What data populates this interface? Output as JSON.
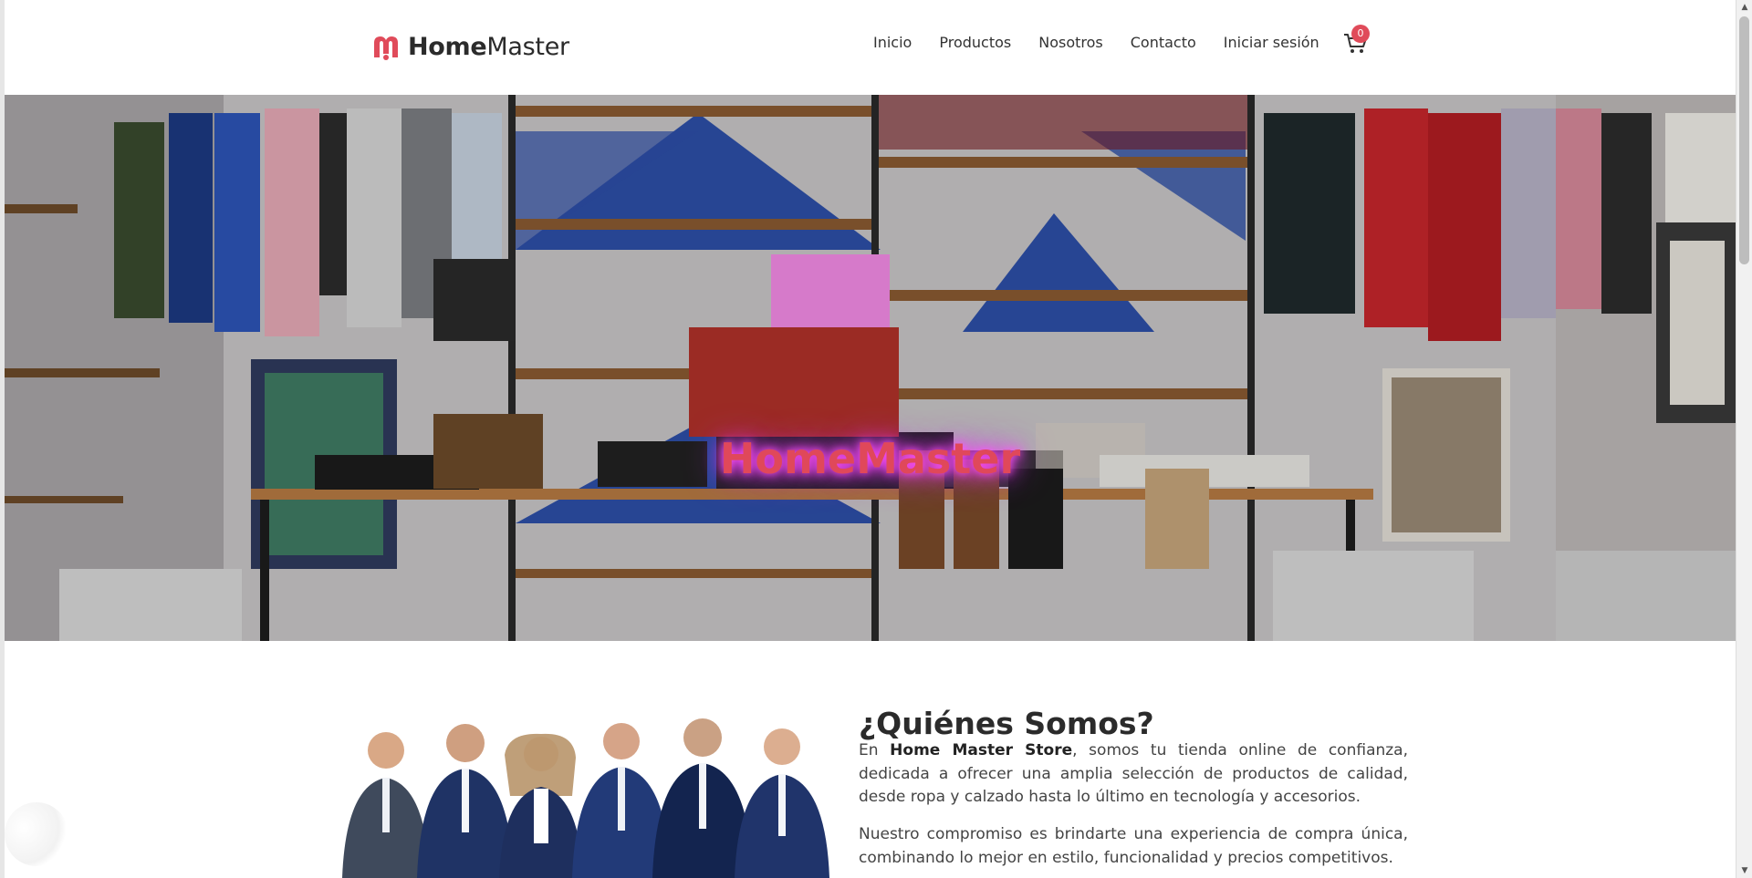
{
  "brand": {
    "name_bold": "Home",
    "name_regular": "Master",
    "accent_color": "#e04b5a"
  },
  "nav": {
    "items": [
      "Inicio",
      "Productos",
      "Nosotros",
      "Contacto",
      "Iniciar sesión"
    ]
  },
  "cart": {
    "icon": "shopping-cart-icon",
    "count": "0"
  },
  "hero": {
    "title": "HomeMaster",
    "title_color": "#e0485a",
    "glow_color": "#ff3ef8"
  },
  "about": {
    "title": "¿Quiénes Somos?",
    "p1_prefix": "En ",
    "p1_bold": "Home Master Store",
    "p1_rest": ", somos tu tienda online de confianza, dedicada a ofrecer una amplia selección de productos de calidad, desde ropa y calzado hasta lo último en tecnología y accesorios.",
    "p2": "Nuestro compromiso es brindarte una experiencia de compra única, combinando lo mejor en estilo, funcionalidad y precios competitivos."
  }
}
